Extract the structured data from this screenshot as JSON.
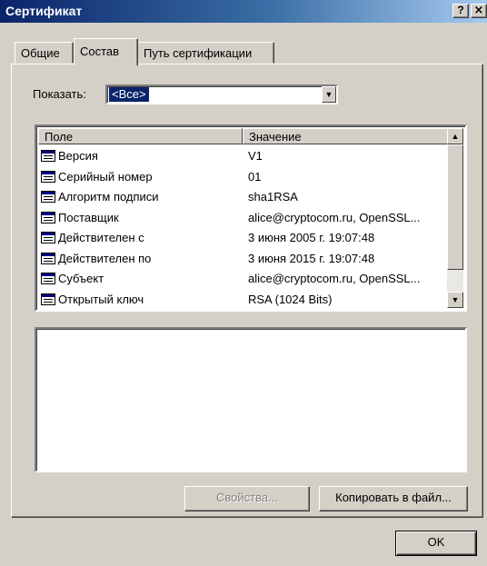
{
  "window": {
    "title": "Сертификат",
    "help_label": "?",
    "close_label": "×"
  },
  "tabs": [
    {
      "label": "Общие",
      "active": false
    },
    {
      "label": "Состав",
      "active": true
    },
    {
      "label": "Путь сертификации",
      "active": false
    }
  ],
  "show": {
    "label": "Показать:",
    "selected": "<Все>",
    "arrow": "▼"
  },
  "list": {
    "columns": [
      "Поле",
      "Значение"
    ],
    "rows": [
      {
        "field": "Версия",
        "value": "V1"
      },
      {
        "field": "Серийный номер",
        "value": "01"
      },
      {
        "field": "Алгоритм подписи",
        "value": "sha1RSA"
      },
      {
        "field": "Поставщик",
        "value": "alice@cryptocom.ru, OpenSSL..."
      },
      {
        "field": "Действителен с",
        "value": "3 июня 2005 г. 19:07:48"
      },
      {
        "field": "Действителен по",
        "value": "3 июня 2015 г. 19:07:48"
      },
      {
        "field": "Субъект",
        "value": "alice@cryptocom.ru, OpenSSL..."
      },
      {
        "field": "Открытый ключ",
        "value": "RSA (1024 Bits)"
      }
    ],
    "scroll_up": "▲",
    "scroll_down": "▼"
  },
  "buttons": {
    "properties": "Свойства...",
    "copy_to_file": "Копировать в файл...",
    "ok": "OK"
  },
  "colors": {
    "title_bar": "#0a246a",
    "face": "#d4d0c8",
    "selection": "#0a246a"
  }
}
